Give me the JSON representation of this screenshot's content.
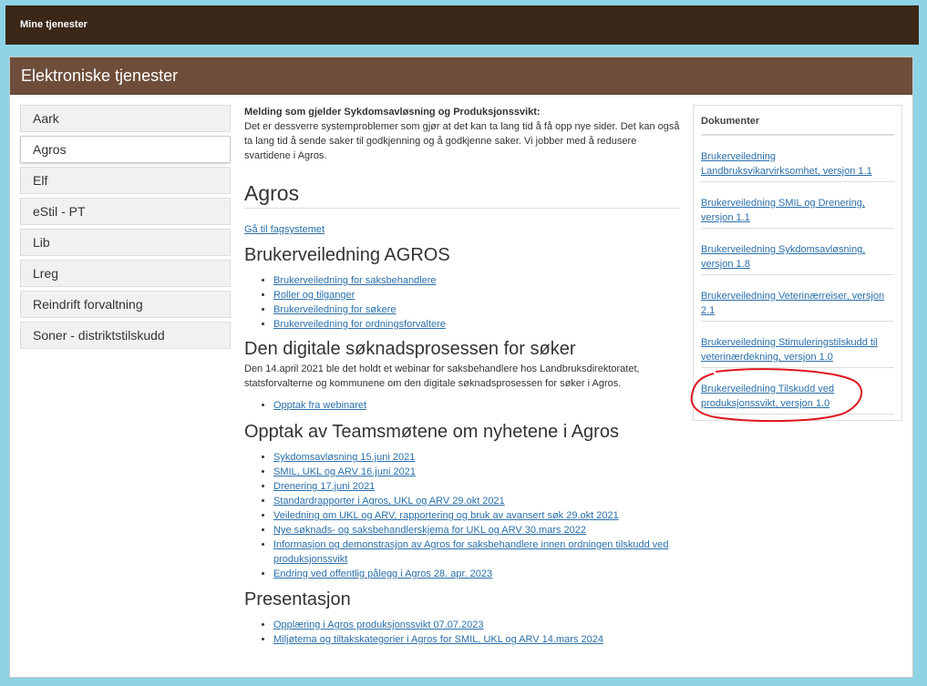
{
  "topbar": {
    "brand": "Mine tjenester"
  },
  "panel": {
    "title": "Elektroniske tjenester"
  },
  "nav": [
    {
      "label": "Aark",
      "active": false
    },
    {
      "label": "Agros",
      "active": true
    },
    {
      "label": "Elf",
      "active": false
    },
    {
      "label": "eStil - PT",
      "active": false
    },
    {
      "label": "Lib",
      "active": false
    },
    {
      "label": "Lreg",
      "active": false
    },
    {
      "label": "Reindrift forvaltning",
      "active": false
    },
    {
      "label": "Soner - distriktstilskudd",
      "active": false
    }
  ],
  "notice": {
    "heading": "Melding som gjelder Sykdomsavløsning og Produksjonssvikt:",
    "body": "Det er dessverre systemproblemer som gjør at det kan ta lang tid å få opp nye sider. Det kan også ta lang tid å sende saker til godkjenning og å godkjenne saker. Vi jobber med å redusere svartidene i Agros."
  },
  "main": {
    "title": "Agros",
    "fagsystem_link": "Gå til fagsystemet",
    "section1": {
      "title": "Brukerveiledning AGROS",
      "links": [
        "Brukerveiledning for saksbehandlere",
        "Roller og tilganger",
        "Brukerveiledning for søkere",
        "Brukerveiledning for ordningsforvaltere"
      ]
    },
    "section2": {
      "title": "Den digitale søknadsprosessen for søker",
      "text": "Den 14.april 2021 ble det holdt et webinar for saksbehandlere hos Landbruksdirektoratet, statsforvalterne og kommunene om den digitale søknadsprosessen for søker i Agros.",
      "links": [
        "Opptak fra webinaret"
      ]
    },
    "section3": {
      "title": "Opptak av Teamsmøtene om nyhetene i Agros",
      "links": [
        "Sykdomsavløsning 15.juni 2021",
        "SMIL, UKL og ARV 16.juni 2021",
        "Drenering 17.juni 2021",
        "Standardrapporter i Agros, UKL og ARV 29.okt 2021",
        "Veiledning om UKL og ARV, rapportering og bruk av avansert søk 29.okt 2021",
        "Nye søknads- og saksbehandlerskjema for UKL og ARV 30.mars 2022",
        "Informasjon og demonstrasjon av Agros for saksbehandlere innen ordningen tilskudd ved produksjonssvikt",
        "Endring ved offentlig pålegg i Agros 28. apr. 2023"
      ]
    },
    "section4": {
      "title": "Presentasjon",
      "links": [
        "Opplæring i Agros produksjonssvikt 07.07.2023",
        "Miljøtema og tiltakskategorier i Agros for SMIL, UKL og ARV 14.mars 2024"
      ]
    }
  },
  "docs": {
    "title": "Dokumenter",
    "items": [
      "Brukerveiledning Landbruksvikarvirksomhet, versjon 1.1",
      "Brukerveiledning SMIL og Drenering, versjon 1.1",
      "Brukerveiledning Sykdomsavløsning, versjon 1.8",
      "Brukerveiledning Veterinærreiser, versjon 2.1",
      "Brukerveiledning Stimuleringstilskudd til veterinærdekning, versjon 1.0",
      "Brukerveiledning Tilskudd ved produksjonssvikt, versjon 1.0"
    ]
  },
  "colors": {
    "topbar": "#3a2718",
    "panel_header": "#6e4e3b",
    "background": "#8fd3e6",
    "link": "#2a6faa",
    "annotation": "#e0141e"
  }
}
